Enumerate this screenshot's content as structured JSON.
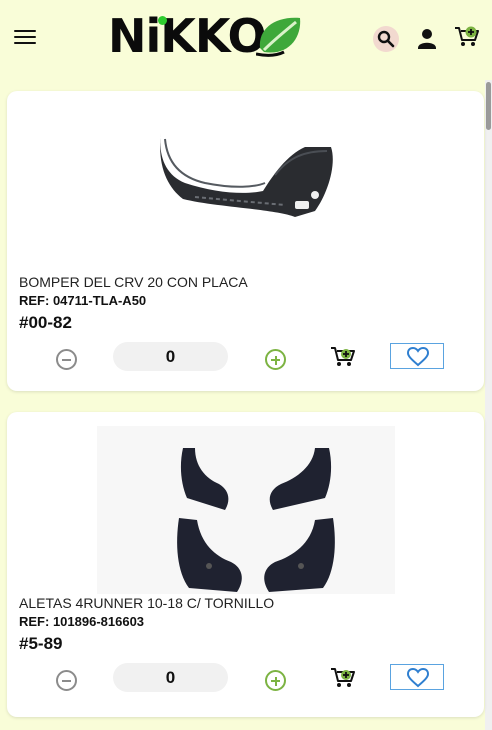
{
  "header": {
    "logo_text": "NiKKO",
    "icons": [
      "menu-icon",
      "search-icon",
      "user-icon",
      "cart-icon"
    ]
  },
  "products": [
    {
      "name": "BOMPER DEL CRV 20 CON PLACA",
      "ref": "REF: 04711-TLA-A50",
      "price": "#00-82",
      "quantity": "0"
    },
    {
      "name": "ALETAS 4RUNNER 10-18 C/ TORNILLO",
      "ref": "REF: 101896-816603",
      "price": "#5-89",
      "quantity": "0"
    }
  ],
  "colors": {
    "background": "#f9fdd8",
    "card": "#ffffff",
    "plus_green": "#7cb342",
    "favorite_blue": "#5aa3e0"
  }
}
